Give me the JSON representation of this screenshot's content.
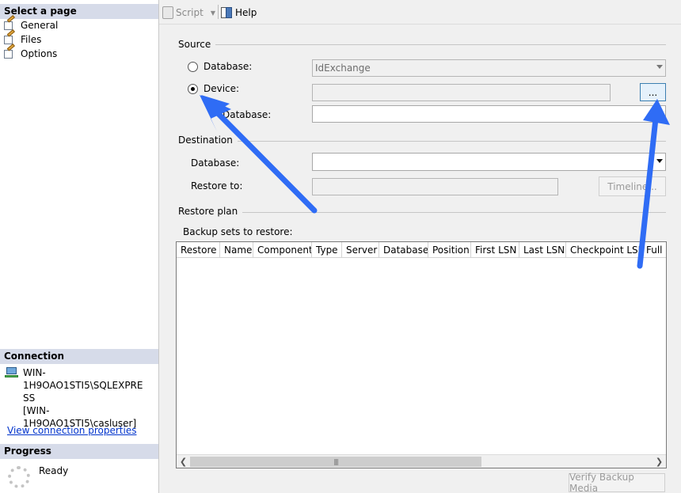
{
  "left": {
    "select_page": {
      "header": "Select a page",
      "items": [
        {
          "label": "General",
          "icon": "page-settings-icon"
        },
        {
          "label": "Files",
          "icon": "page-settings-icon"
        },
        {
          "label": "Options",
          "icon": "page-settings-icon"
        }
      ]
    },
    "connection": {
      "header": "Connection",
      "server_line1": "WIN-1H9OAO1STI5\\SQLEXPRE",
      "server_line2": "SS",
      "user": "[WIN-1H9OAO1STI5\\casluser]",
      "view_link": "View connection properties"
    },
    "progress": {
      "header": "Progress",
      "status": "Ready"
    }
  },
  "toolbar": {
    "script_label": "Script",
    "help_label": "Help"
  },
  "source": {
    "group_label": "Source",
    "database_radio_label": "Database:",
    "database_value": "IdExchange",
    "device_radio_label": "Device:",
    "device_value": "",
    "device_browse_label": "...",
    "selected": "device",
    "database_label": "Database:"
  },
  "destination": {
    "group_label": "Destination",
    "database_label": "Database:",
    "database_value": "",
    "restore_to_label": "Restore to:",
    "restore_to_value": "",
    "timeline_label": "Timeline..."
  },
  "restore_plan": {
    "group_label": "Restore plan",
    "backup_sets_label": "Backup sets to restore:",
    "columns": [
      "Restore",
      "Name",
      "Component",
      "Type",
      "Server",
      "Database",
      "Position",
      "First LSN",
      "Last LSN",
      "Checkpoint LSN",
      "Full LS"
    ],
    "rows": []
  },
  "verify_button_label": "Verify Backup Media",
  "annotations": {
    "arrow_color": "#2f6cf5"
  }
}
